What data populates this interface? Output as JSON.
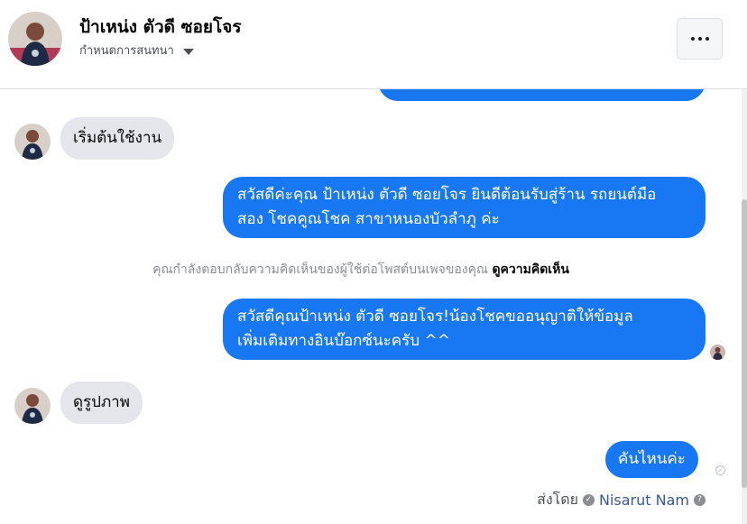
{
  "header": {
    "name": "ป้าเหน่ง ตัวดี ซอยโจร",
    "subtitle": "กำหนดการสนทนา",
    "more_icon": "more-horizontal-icon"
  },
  "messages": {
    "m1": "เริ่มต้นใช้งาน",
    "m2_line1": "สวัสดีค่ะคุณ ป้าเหน่ง ตัวดี ซอยโจร ยินดีต้อนรับสู่ร้าน รถยนต์มือ",
    "m2_line2": "สอง โชคคูณโชค สาขาหนองบัวลำภู ค่ะ",
    "notice_text": "คุณกำลังตอบกลับความคิดเห็นของผู้ใช้ต่อโพสต์บนเพจของคุณ",
    "notice_link": "ดูความคิดเห็น",
    "m3_line1": "สวัสดีคุณป้าเหน่ง ตัวดี ซอยโจร!น้องโชคขออนุญาติให้ข้อมูล",
    "m3_line2": "เพิ่มเติมทางอินบ๊อกซ์นะครับ ^^",
    "m4": "ดูรูปภาพ",
    "m5": "คันไหนค่ะ"
  },
  "footer": {
    "sent_by_label": "ส่งโดย",
    "sender_name": "Nisarut Nam"
  },
  "colors": {
    "outgoing": "#1877f2",
    "incoming": "#e4e6eb",
    "link": "#385898"
  }
}
